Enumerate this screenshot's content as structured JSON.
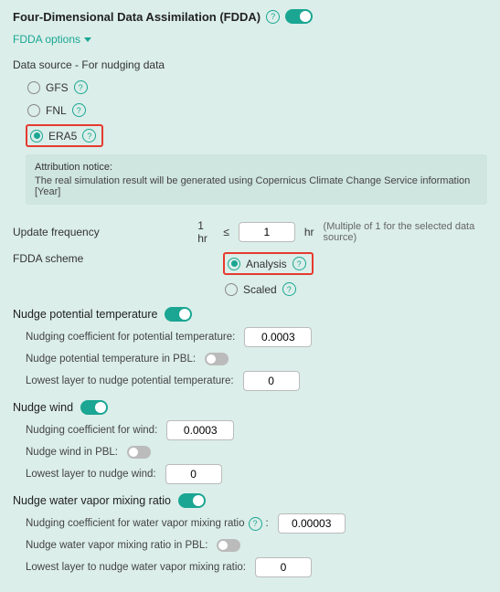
{
  "header": {
    "title": "Four-Dimensional Data Assimilation (FDDA)"
  },
  "options_link": "FDDA options",
  "data_source": {
    "label": "Data source - For nudging data",
    "options": [
      "GFS",
      "FNL",
      "ERA5"
    ]
  },
  "notice": {
    "title": "Attribution notice:",
    "body": "The real simulation result will be generated using Copernicus Climate Change Service information [Year]"
  },
  "update_freq": {
    "label": "Update frequency",
    "prefix": "1 hr",
    "op": "≤",
    "value": "1",
    "unit": "hr",
    "hint": "(Multiple of 1 for the selected data source)"
  },
  "scheme": {
    "label": "FDDA scheme",
    "options": [
      "Analysis",
      "Scaled"
    ]
  },
  "nudge_temp": {
    "title": "Nudge potential temperature",
    "coef_label": "Nudging coefficient for potential temperature:",
    "coef_value": "0.0003",
    "pbl_label": "Nudge potential temperature in PBL:",
    "layer_label": "Lowest layer to nudge potential temperature:",
    "layer_value": "0"
  },
  "nudge_wind": {
    "title": "Nudge wind",
    "coef_label": "Nudging coefficient for wind:",
    "coef_value": "0.0003",
    "pbl_label": "Nudge wind in PBL:",
    "layer_label": "Lowest layer to nudge wind:",
    "layer_value": "0"
  },
  "nudge_vapor": {
    "title": "Nudge water vapor mixing ratio",
    "coef_label": "Nudging coefficient for water vapor mixing ratio",
    "coef_value": "0.00003",
    "pbl_label": "Nudge water vapor mixing ratio in PBL:",
    "layer_label": "Lowest layer to nudge water vapor mixing ratio:",
    "layer_value": "0"
  }
}
